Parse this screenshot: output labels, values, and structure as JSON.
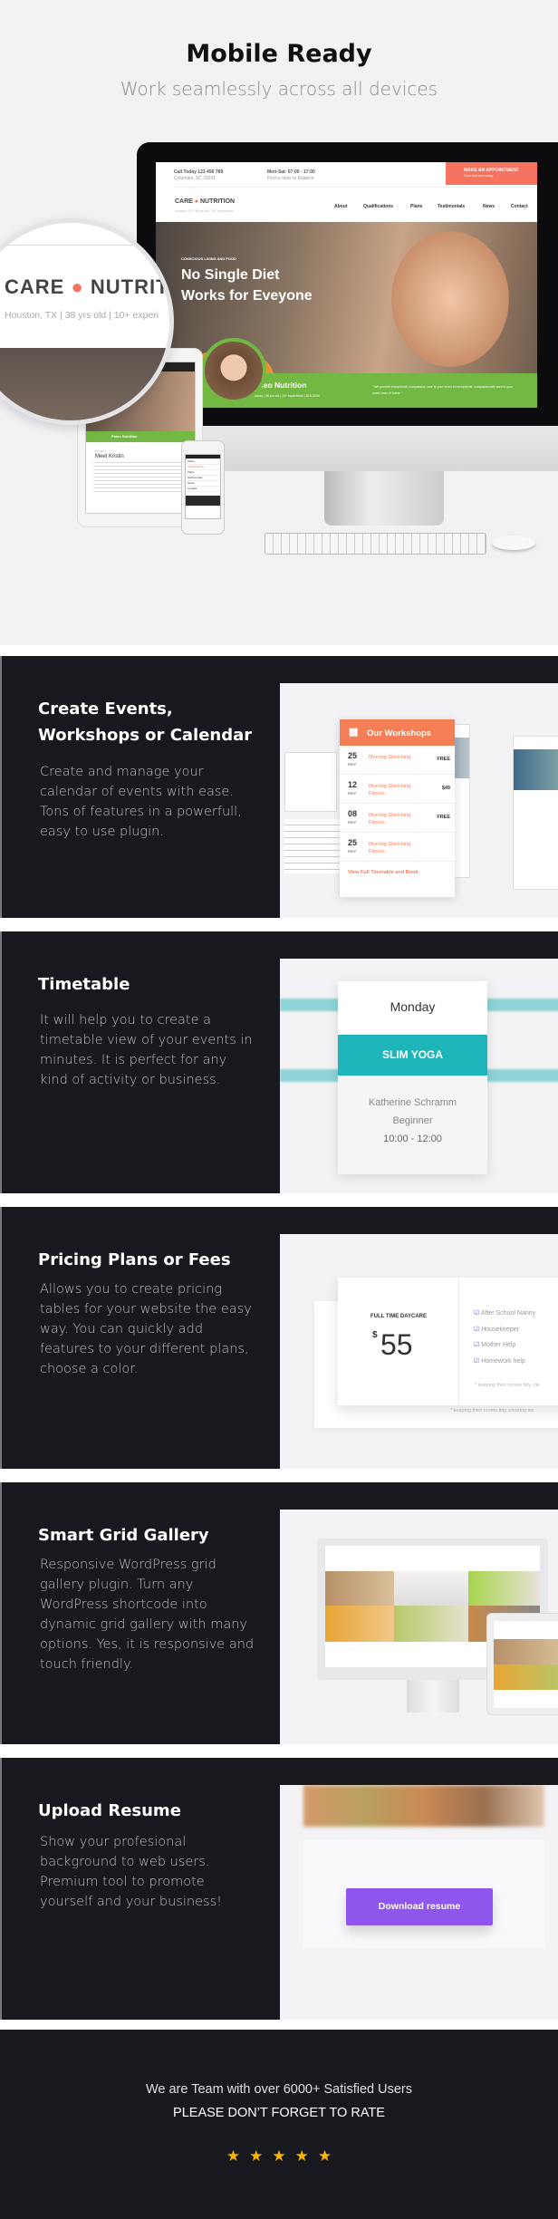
{
  "hero": {
    "title": "Mobile Ready",
    "subtitle": "Work seamlessly across all devices"
  },
  "mockup": {
    "topbar": {
      "call": "Call Today 123 456 789",
      "address": "Columbia, SC 29201",
      "hours": "Mon-Sat: 07:00 - 17:00",
      "hours_sub": "Find a class to Balance",
      "cta": "MAKE AN APPOINTMENT",
      "cta_sub": "Connect me today"
    },
    "logo_left": "CARE",
    "logo_right": "NUTRITION",
    "logo_sub": "Houston, TX | 38 yrs old | 10+ experience",
    "nav": [
      "About",
      "Qualifications",
      "Plans",
      "Testimonials",
      "News",
      "Contact"
    ],
    "kicker": "CONSCIOUS LIVING AND FOOD",
    "headline1": "No Single Diet",
    "headline2": "Works for Eveyone",
    "green_title": "Paleo Nutrition",
    "green_sub": "Lindsay | 38 yrs old | 10+ experience | $15-30/hr",
    "quote": "“ We provide exceptional, compassion care to your loved in exceptional, compassionate care to your loved ones of home. ”",
    "magnifier": {
      "logo_left": "CARE",
      "logo_right": "NUTRITIC",
      "sub": "Houston, TX | 38 yrs old | 10+ experi"
    },
    "tablet": {
      "green_title": "Paleo Nutrition",
      "kicker": "My Story",
      "heading": "Meet Kristin"
    }
  },
  "colors": {
    "dark": "#18191e",
    "orange": "#f47f57",
    "teal": "#1eb5ba",
    "green": "#73b843",
    "coral": "#f6735f",
    "purple": "#8e56ec",
    "star": "#f7b500"
  },
  "features": [
    {
      "title": "Create Events, Workshops or Calendar",
      "body": "Create and manage your calendar of events with ease. Tons of features in a powerfull, easy to use plugin."
    },
    {
      "title": "Timetable",
      "body": "It will help you to create a timetable view of your events in minutes. It is perfect for any kind of activity or business."
    },
    {
      "title": "Pricing Plans or Fees",
      "body": "Allows you to create pricing tables for your website the easy way. You can quickly add features to your different plans, choose a color."
    },
    {
      "title": "Smart Grid Gallery",
      "body": "Responsive WordPress grid gallery plugin. Turn any WordPress shortcode into dynamic grid gallery with many options. Yes, it is responsive and touch friendly."
    },
    {
      "title": "Upload Resume",
      "body": "Show your profesional background to web users. Premium tool to promote yourself and your business!"
    }
  ],
  "workshops": {
    "title": "Our Workshops",
    "rows": [
      {
        "day": "25",
        "month": "MAY",
        "name": "Morning Stretching",
        "price": "FREE"
      },
      {
        "day": "12",
        "month": "MAY",
        "name": "Morning Stretching Fitness",
        "price": "$49"
      },
      {
        "day": "08",
        "month": "MAY",
        "name": "Morning Stretching Fitness",
        "price": "FREE"
      },
      {
        "day": "25",
        "month": "MAY",
        "name": "Morning Stretching Fitness",
        "price": ""
      }
    ],
    "link": "View Full Timetable and Book"
  },
  "timetable": {
    "day": "Monday",
    "event": "SLIM YOGA",
    "instructor": "Katherine Schramm",
    "level": "Beginner",
    "time": "10:00 - 12:00"
  },
  "pricing": {
    "plan": "FULL TIME DAYCARE",
    "currency": "$",
    "price": "55",
    "features": [
      "After School Nanny",
      "Housekeeper",
      "Mother Help",
      "Homework help"
    ],
    "note": "* keeping their rooms tidy, cle",
    "note_back": "* keeping their rooms tidy, clearing aw"
  },
  "resume": {
    "button": "Download resume"
  },
  "footer": {
    "line1": "We are Team with over 6000+ Satisfied Users",
    "line2": "PLEASE DON’T FORGET TO RATE",
    "rating": 5
  }
}
